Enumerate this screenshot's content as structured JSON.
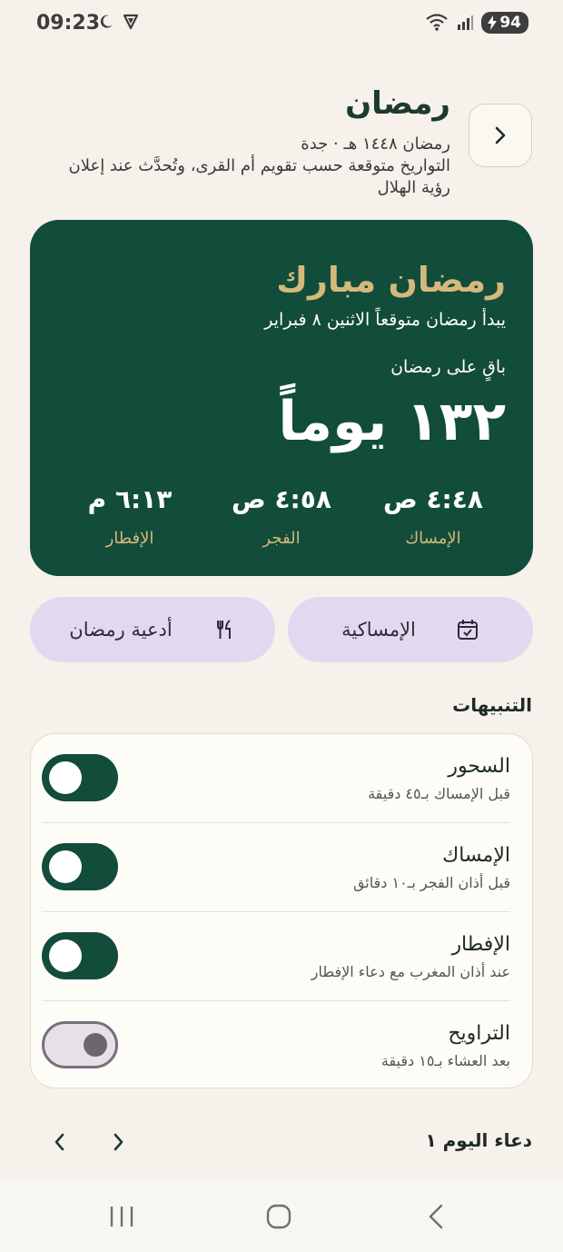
{
  "status_bar": {
    "time": "09:23",
    "battery": "94",
    "icons": [
      "moon-icon",
      "vpn-shield-icon",
      "wifi-icon",
      "signal-icon",
      "battery-charging-icon"
    ]
  },
  "header": {
    "title": "رمضان",
    "subtitle": "رمضان ١٤٤٨ هـ · جدة",
    "note": "التواريخ متوقعة حسب تقويم أم القرى، وتُحدَّث عند إعلان رؤية الهلال"
  },
  "hero": {
    "title": "رمضان مبارك",
    "subtitle": "يبدأ رمضان متوقعاً الاثنين ٨ فبراير",
    "remaining_label": "باقٍ على رمضان",
    "days": "١٣٢ يوماً",
    "times": [
      {
        "value": "٤:٤٨ ص",
        "label": "الإمساك"
      },
      {
        "value": "٤:٥٨ ص",
        "label": "الفجر"
      },
      {
        "value": "٦:١٣ م",
        "label": "الإفطار"
      }
    ]
  },
  "actions": {
    "imsakiya": "الإمساكية",
    "duas": "أدعية رمضان"
  },
  "notifications": {
    "title": "التنبيهات",
    "items": [
      {
        "title": "السحور",
        "desc": "قبل الإمساك بـ٤٥ دقيقة",
        "enabled": true
      },
      {
        "title": "الإمساك",
        "desc": "قبل أذان الفجر بـ١٠ دقائق",
        "enabled": true
      },
      {
        "title": "الإفطار",
        "desc": "عند أذان المغرب مع دعاء الإفطار",
        "enabled": true
      },
      {
        "title": "التراويح",
        "desc": "بعد العشاء بـ١٥ دقيقة",
        "enabled": false
      }
    ]
  },
  "daily_dua": {
    "label": "دعاء اليوم ١"
  },
  "colors": {
    "background": "#f6f1ea",
    "primary_green": "#124c3b",
    "gold": "#d4b97a",
    "lavender": "#e2d9f1"
  }
}
